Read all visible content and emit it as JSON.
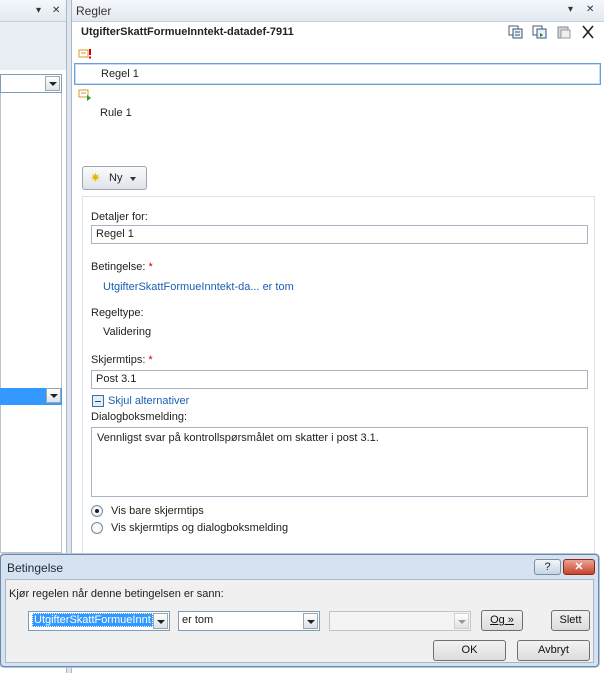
{
  "left_pane": {
    "pin_label": "▾",
    "close_label": "✕"
  },
  "rules_pane": {
    "title": "Regler",
    "pin_label": "▾",
    "close_label": "✕",
    "control_name": "UtgifterSkattFormueInntekt-datadef-7911",
    "toolbar_icons": [
      "copy-icon",
      "copy-all-icon",
      "paste-icon",
      "delete-icon"
    ],
    "close_x": "✕",
    "rules": [
      {
        "label": "Regel 1",
        "icon": "validation-rule-icon",
        "selected": true
      },
      {
        "label": "Rule 1",
        "icon": "action-rule-icon",
        "selected": false
      }
    ],
    "new_button": {
      "label": "Ny",
      "icon": "new-star-icon"
    },
    "details": {
      "details_for_label": "Detaljer for:",
      "details_for_value": "Regel 1",
      "condition_label": "Betingelse:",
      "condition_link": "UtgifterSkattFormueInntekt-da... er tom",
      "rule_type_label": "Regeltype:",
      "rule_type_value": "Validering",
      "screentip_label": "Skjermtips:",
      "screentip_value": "Post 3.1",
      "hide_alternatives": "Skjul alternativer",
      "dialog_message_label": "Dialogboksmelding:",
      "dialog_message_value": "Vennligst svar på kontrollspørsmålet om skatter i post 3.1.",
      "radio_options": [
        {
          "label": "Vis bare skjermtips",
          "checked": true
        },
        {
          "label": "Vis skjermtips og dialogboksmelding",
          "checked": false
        }
      ],
      "required_mark": "*"
    }
  },
  "dialog": {
    "title": "Betingelse",
    "help_label": "?",
    "close_label": "✕",
    "prompt": "Kjør regelen når denne betingelsen er sann:",
    "field_select": "UtgifterSkattFormueInnt",
    "operator_select": "er tom",
    "value_select": "",
    "and_button": "Og »",
    "delete_button": "Slett",
    "ok_button": "OK",
    "cancel_button": "Avbryt"
  }
}
